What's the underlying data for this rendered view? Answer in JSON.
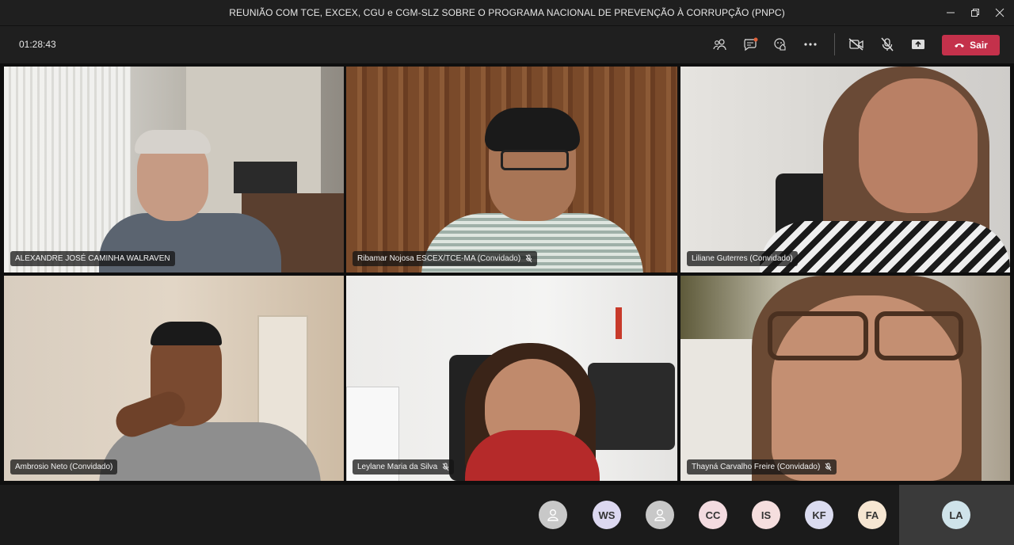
{
  "window": {
    "title": "REUNIÃO COM TCE, EXCEX, CGU e CGM-SLZ SOBRE O PROGRAMA NACIONAL DE PREVENÇÃO À CORRUPÇÃO (PNPC)",
    "minimize_icon": "minimize-icon",
    "maximize_icon": "restore-icon",
    "close_icon": "close-icon"
  },
  "toolbar": {
    "timer": "01:28:43",
    "icons": [
      "participants-icon",
      "chat-icon",
      "reactions-icon",
      "more-options-icon",
      "camera-off-icon",
      "mic-off-icon",
      "share-screen-icon"
    ],
    "leave_label": "Sair",
    "leave_color": "#c4314b"
  },
  "participants": [
    {
      "name": "ALEXANDRE JOSÉ CAMINHA WALRAVEN",
      "muted": false
    },
    {
      "name": "Ribamar Nojosa ESCEX/TCE-MA (Convidado)",
      "muted": true
    },
    {
      "name": "Liliane Guterres (Convidado)",
      "muted": false
    },
    {
      "name": "Ambrosio Neto (Convidado)",
      "muted": false
    },
    {
      "name": "Leylane Maria da Silva",
      "muted": true
    },
    {
      "name": "Thayná Carvalho Freire (Convidado)",
      "muted": true
    }
  ],
  "roster": [
    {
      "initials": "",
      "icon": "person-icon",
      "color": "#c8c8c8"
    },
    {
      "initials": "WS",
      "color": "#dcd8f0"
    },
    {
      "initials": "",
      "icon": "person-icon",
      "color": "#c8c8c8"
    },
    {
      "initials": "CC",
      "color": "#f3dbe0"
    },
    {
      "initials": "IS",
      "color": "#f5dede"
    },
    {
      "initials": "KF",
      "color": "#dbdcf0"
    },
    {
      "initials": "FA",
      "color": "#f6e6d2"
    }
  ],
  "self_view": {
    "initials": "LA",
    "color": "#cfe3ea"
  }
}
